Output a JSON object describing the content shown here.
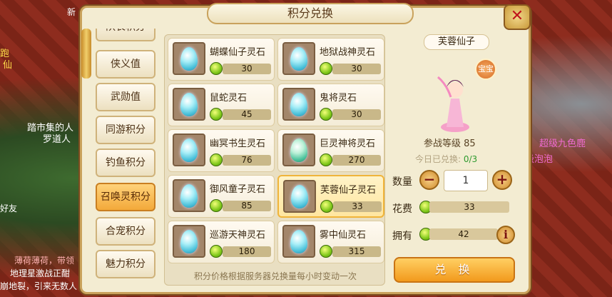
{
  "background": {
    "texts": [
      "新",
      "踏市集的人",
      "罗道人",
      "超级九色鹿",
      "级泡泡",
      "薄荷薄荷，带领",
      "地理星激战正酣",
      "崩地裂，引来无数人",
      "跑",
      "仙",
      "好友"
    ]
  },
  "dialog": {
    "title": "积分兑换"
  },
  "tabs": [
    {
      "label": "队长积分"
    },
    {
      "label": "侠义值"
    },
    {
      "label": "武勋值"
    },
    {
      "label": "同游积分"
    },
    {
      "label": "钓鱼积分"
    },
    {
      "label": "召唤灵积分",
      "active": true
    },
    {
      "label": "合宠积分"
    },
    {
      "label": "魅力积分"
    }
  ],
  "items": [
    {
      "name": "蝴蝶仙子灵石",
      "cost": "30"
    },
    {
      "name": "地狱战神灵石",
      "cost": "30"
    },
    {
      "name": "鼠蛇灵石",
      "cost": "45"
    },
    {
      "name": "鬼将灵石",
      "cost": "30"
    },
    {
      "name": "幽冥书生灵石",
      "cost": "76"
    },
    {
      "name": "巨灵神将灵石",
      "cost": "270"
    },
    {
      "name": "御风童子灵石",
      "cost": "85"
    },
    {
      "name": "芙蓉仙子灵石",
      "cost": "33"
    },
    {
      "name": "巡游天神灵石",
      "cost": "180"
    },
    {
      "name": "雾中仙灵石",
      "cost": "315"
    }
  ],
  "note": "积分价格根据服务器兑换量每小时变动一次",
  "detail": {
    "name": "芙蓉仙子",
    "badge": "宝宝",
    "level_label": "参战等级",
    "level": "85",
    "today_label": "今日已兑换:",
    "today_count": "0/3",
    "qty_label": "数量",
    "qty": "1",
    "cost_label": "花费",
    "cost": "33",
    "own_label": "拥有",
    "own": "42",
    "exchange_button": "兑 换"
  },
  "colors": {
    "accent": "#f29a1c",
    "selected_tab": "#f3a93a",
    "coin": "#7fc81a",
    "close": "#c0141b"
  }
}
